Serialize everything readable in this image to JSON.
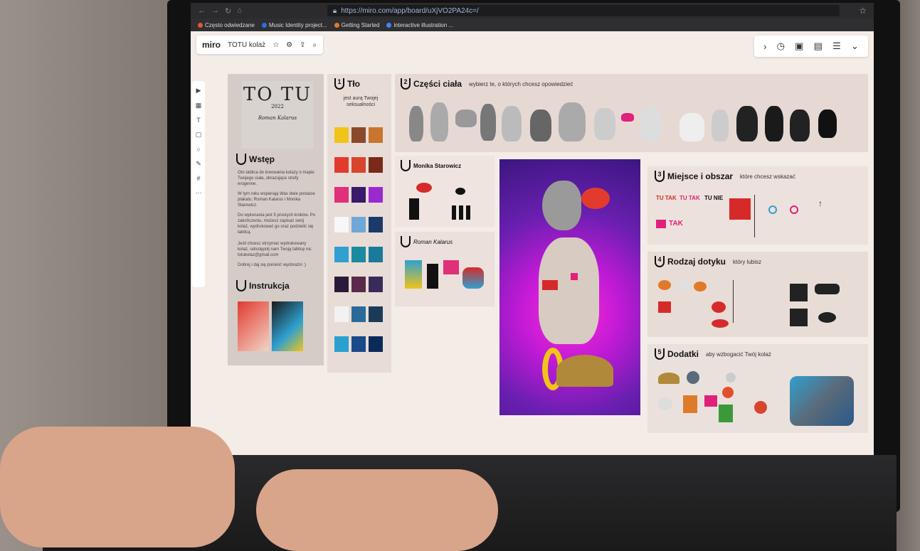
{
  "browser": {
    "url": "https://miro.com/app/board/uXjVO2PA24c=/",
    "star_icon": "star-icon",
    "bookmarks": [
      "Często odwiedzane",
      "Music Identity project...",
      "Getting Started",
      "interactive illustration ..."
    ],
    "bookmark_colors": [
      "#e05b2b",
      "#2b6fe0",
      "#e07a2b",
      "#4285f4"
    ]
  },
  "miro": {
    "logo": "miro",
    "board_name": "TOTU kolaż",
    "right_tools": [
      "timer-icon",
      "sticky-icon",
      "comment-icon",
      "notes-icon",
      "more-icon"
    ]
  },
  "board": {
    "cover": {
      "logo_text": "TO TU",
      "year": "2022",
      "signature": "Roman Kalarus",
      "wstep_title": "Wstęp",
      "intro_1": "Oto tablica do kreowania kolaży o mapie Twojego ciała, obrazujące strefy erogenne.",
      "intro_2": "W tym roku wspierają Was dwie postacie plakatu: Roman Kalarus i Monika Starowicz.",
      "intro_3": "Do wykonania jest 5 prostych kroków. Po zakończeniu, możesz zapisać swój kolaż, wydrukować go oraz podzielić się tablicą.",
      "intro_4": "Jeśli chcesz otrzymać wydrukowany kolaż, udostępnij nam Twoją tablicę na: totukolaz@gmail.com",
      "intro_5": "Dobrej i daj się ponieść wyobraźni :)",
      "instrukcja_title": "Instrukcja"
    },
    "step1": {
      "num": "1",
      "title": "Tło",
      "subtitle": "jest aurą Twojej seksualności"
    },
    "step2": {
      "num": "2",
      "title": "Części ciała",
      "subtitle": "wybierz te, o których chcesz opowiedzieć"
    },
    "monika_label": "Monika Starowicz",
    "kalarus_label": "Roman Kalarus",
    "step3": {
      "num": "3",
      "title": "Miejsce i obszar",
      "subtitle": "które chcesz wskazać",
      "tak": "TAK",
      "tu_tak": "TU TAK",
      "tu_nie": "TU NIE"
    },
    "step4": {
      "num": "4",
      "title": "Rodzaj dotyku",
      "subtitle": "który lubisz"
    },
    "step5": {
      "num": "5",
      "title": "Dodatki",
      "subtitle": "aby wzbogacić Twój kolaż"
    }
  },
  "colors": {
    "swatches": [
      "#f0c419",
      "#8a4a2a",
      "#c9752e",
      "#e23b2e",
      "#d9452c",
      "#7a2a18",
      "#e0307a",
      "#3a1a6a",
      "#9a2ad0",
      "#f7f7f7",
      "#6fa8d8",
      "#1a3a6a",
      "#2fa0d0",
      "#1a8aa0",
      "#1a7a9a",
      "#2a1a3a",
      "#5a2a4a",
      "#3a2a5a",
      "#f2f2f2",
      "#2a6a9a",
      "#1a3a5a",
      "#2aa0d0",
      "#1a4a8a",
      "#0a2a5a"
    ],
    "accent_pink": "#e0207a",
    "accent_red": "#d62a2a"
  }
}
